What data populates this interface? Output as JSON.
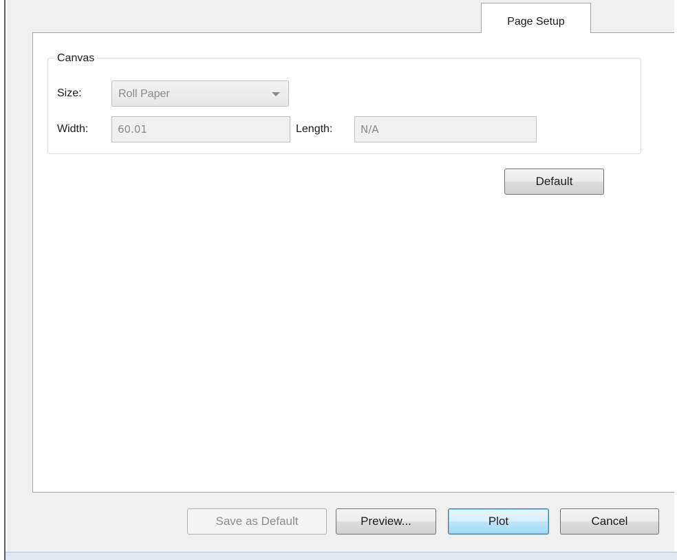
{
  "tabs": [
    {
      "label": "Page Setup",
      "active": true
    }
  ],
  "canvas": {
    "group_title": "Canvas",
    "size_label": "Size:",
    "size_value": "Roll Paper",
    "width_label": "Width:",
    "width_value": "60.01",
    "length_label": "Length:",
    "length_value": "N/A"
  },
  "buttons": {
    "default_label": "Default",
    "save_as_default_label": "Save as Default",
    "preview_label": "Preview...",
    "plot_label": "Plot",
    "cancel_label": "Cancel"
  },
  "colors": {
    "dialog_background": "#f0f0f0",
    "panel_background": "#ffffff",
    "disabled_text": "#8a8a8a",
    "default_button_accent": "#3c7fb1"
  },
  "icons": {
    "size_dropdown": "chevron-down-icon"
  }
}
